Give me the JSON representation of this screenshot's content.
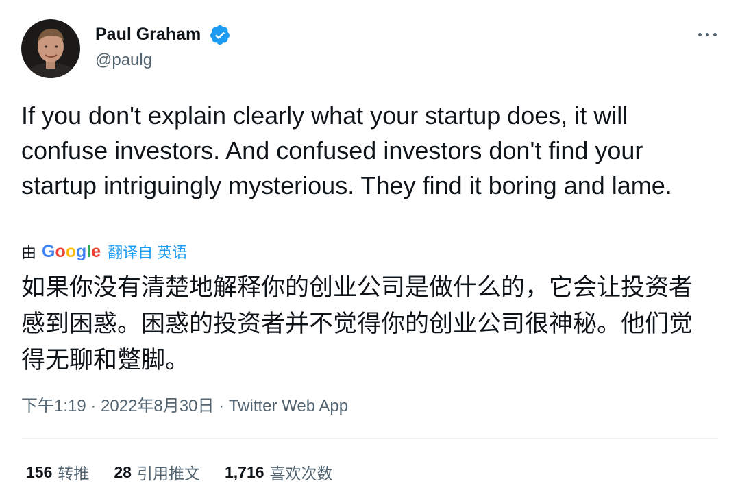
{
  "author": {
    "name": "Paul Graham",
    "handle": "@paulg",
    "verified": true,
    "verified_color": "#1d9bf0"
  },
  "tweet": {
    "text": "If you don't explain clearly what your startup does, it will confuse investors. And confused investors don't find your startup intriguingly mysterious. They find it boring and lame."
  },
  "translation": {
    "by_label": "由",
    "provider": "Google",
    "link_text": "翻译自 英语",
    "text": "如果你没有清楚地解释你的创业公司是做什么的，它会让投资者感到困惑。困惑的投资者并不觉得你的创业公司很神秘。他们觉得无聊和蹩脚。"
  },
  "meta": {
    "time": "下午1:19",
    "separator": " · ",
    "date": "2022年8月30日",
    "source": "Twitter Web App"
  },
  "stats": {
    "retweets_count": "156",
    "retweets_label": "转推",
    "quotes_count": "28",
    "quotes_label": "引用推文",
    "likes_count": "1,716",
    "likes_label": "喜欢次数"
  },
  "icons": {
    "avatar": "profile-photo",
    "verified": "verified-badge-icon",
    "more": "more-options-icon"
  }
}
